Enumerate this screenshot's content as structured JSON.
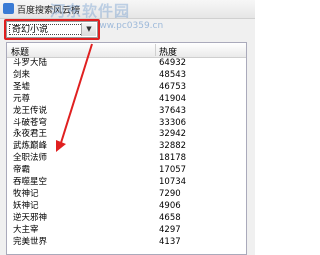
{
  "window": {
    "title": "百度搜索风云榜",
    "watermark": "河东软件园",
    "watermark_url": "www.pc0359.cn"
  },
  "category_select": {
    "value": "奇幻小说"
  },
  "table": {
    "columns": [
      "标题",
      "热度"
    ],
    "rows": [
      {
        "title": "斗罗大陆",
        "heat": "64932"
      },
      {
        "title": "剑来",
        "heat": "48543"
      },
      {
        "title": "圣墟",
        "heat": "46753"
      },
      {
        "title": "元尊",
        "heat": "41904"
      },
      {
        "title": "龙王传说",
        "heat": "37643"
      },
      {
        "title": "斗破苍穹",
        "heat": "33306"
      },
      {
        "title": "永夜君王",
        "heat": "32942"
      },
      {
        "title": "武炼巅峰",
        "heat": "32882"
      },
      {
        "title": "全职法师",
        "heat": "18178"
      },
      {
        "title": "帝霸",
        "heat": "17057"
      },
      {
        "title": "吞噬星空",
        "heat": "10734"
      },
      {
        "title": "牧神记",
        "heat": "7290"
      },
      {
        "title": "妖神记",
        "heat": "4906"
      },
      {
        "title": "逆天邪神",
        "heat": "4658"
      },
      {
        "title": "大主宰",
        "heat": "4297"
      },
      {
        "title": "完美世界",
        "heat": "4137"
      }
    ]
  },
  "colors": {
    "annotation": "#e02020"
  }
}
